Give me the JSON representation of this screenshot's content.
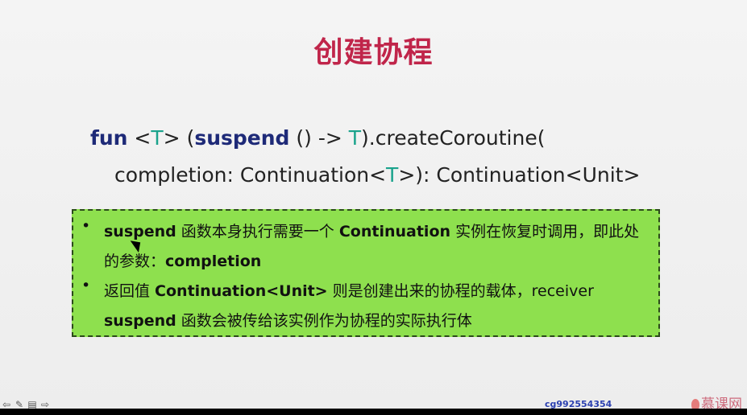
{
  "slide": {
    "title": "创建协程",
    "code": {
      "line1": {
        "fun": "fun",
        "open": " <",
        "T1": "T",
        "close": "> (",
        "suspend": "suspend",
        "mid": " () -> ",
        "T2": "T",
        "tail": ").createCoroutine("
      },
      "line2": {
        "pre": "completion: Continuation<",
        "T": "T",
        "post": ">): Continuation<Unit>"
      }
    },
    "notes": [
      {
        "bold1": "suspend",
        "text1": " 函数本身执行需要一个 ",
        "bold2": "Continuation",
        "text2": " 实例在恢复时调用，即此处的参数：",
        "bold3": "completion"
      },
      {
        "text1": "返回值 ",
        "bold1": "Continuation<Unit>",
        "text2": " 则是创建出来的协程的载体，receiver ",
        "bold2": "suspend",
        "text3": " 函数会被传给该实例作为协程的实际执行体"
      }
    ]
  },
  "footer": {
    "nav_icons": [
      "back-arrow-icon",
      "pen-icon",
      "slides-icon",
      "forward-arrow-icon"
    ],
    "user_id": "cg992554354",
    "brand": "慕课网"
  },
  "colors": {
    "title": "#c0254a",
    "keyword": "#1e2a78",
    "type_param": "#1aa38c",
    "note_box": "#8ee04e"
  }
}
